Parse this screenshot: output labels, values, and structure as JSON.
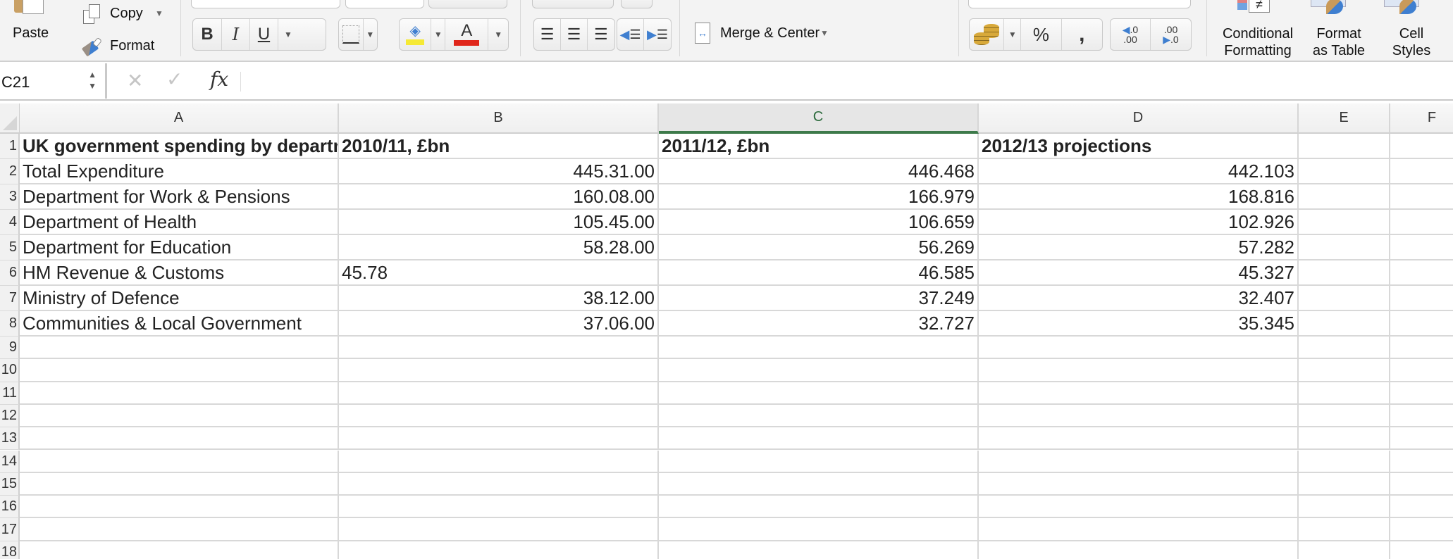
{
  "ribbon": {
    "clipboard": {
      "paste_label": "Paste",
      "copy_label": "Copy",
      "format_label": "Format"
    },
    "font": {
      "bold_label": "B",
      "italic_label": "I",
      "underline_label": "U",
      "font_color_letter": "A",
      "fill_color": "#f5e935",
      "font_color": "#e0261b"
    },
    "alignment": {
      "merge_center_label": "Merge & Center"
    },
    "number": {
      "percent_label": "%",
      "comma_label": ",",
      "increase_decimal_top": ".0",
      "increase_decimal_bottom": ".00",
      "decrease_decimal_top": ".00",
      "decrease_decimal_bottom": ".0"
    },
    "styles": {
      "conditional_formatting_line1": "Conditional",
      "conditional_formatting_line2": "Formatting",
      "format_as_table_line1": "Format",
      "format_as_table_line2": "as Table",
      "cell_styles_line1": "Cell",
      "cell_styles_line2": "Styles"
    }
  },
  "formula_bar": {
    "name_box": "C21",
    "cancel_symbol": "✕",
    "enter_symbol": "✓",
    "fx_label": "fx",
    "formula": ""
  },
  "grid": {
    "columns": [
      "A",
      "B",
      "C",
      "D",
      "E",
      "F"
    ],
    "selected_column": "C",
    "row_numbers": [
      "1",
      "2",
      "3",
      "4",
      "5",
      "6",
      "7",
      "8",
      "9",
      "10",
      "11",
      "12",
      "13",
      "14",
      "15",
      "16",
      "17",
      "18"
    ],
    "header_row": {
      "A": "UK government spending by department",
      "B": "2010/11, £bn",
      "C": "2011/12, £bn",
      "D": "2012/13 projections"
    },
    "rows": [
      {
        "A": "Total Expenditure",
        "B": "445.31.00",
        "C": "446.468",
        "D": "442.103"
      },
      {
        "A": "Department for Work & Pensions",
        "B": "160.08.00",
        "C": "166.979",
        "D": "168.816"
      },
      {
        "A": "Department of Health",
        "B": "105.45.00",
        "C": "106.659",
        "D": "102.926"
      },
      {
        "A": "Department for Education",
        "B": "58.28.00",
        "C": "56.269",
        "D": "57.282"
      },
      {
        "A": "HM Revenue & Customs",
        "B": "45.78",
        "C": "46.585",
        "D": "45.327"
      },
      {
        "A": "Ministry of Defence",
        "B": "38.12.00",
        "C": "37.249",
        "D": "32.407"
      },
      {
        "A": "Communities & Local Government",
        "B": "37.06.00",
        "C": "32.727",
        "D": "35.345"
      }
    ]
  }
}
